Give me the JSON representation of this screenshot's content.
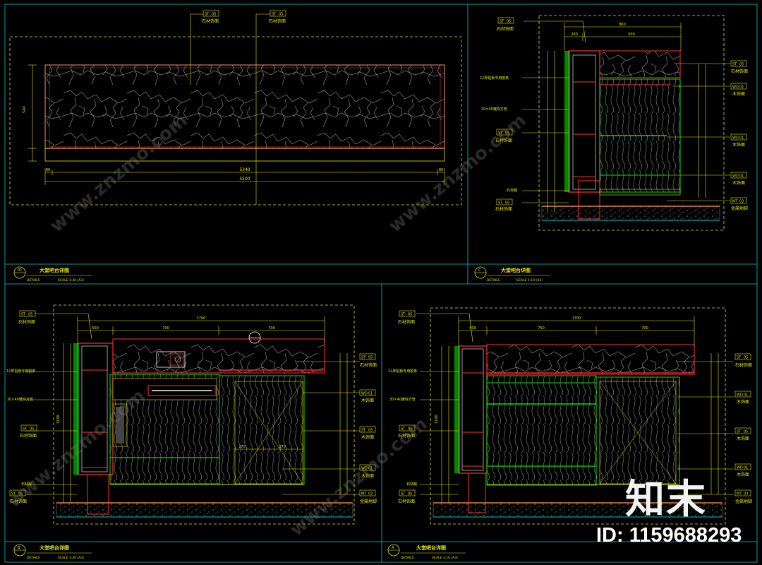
{
  "panels": [
    {
      "id": "01",
      "title": "大堂吧台详图",
      "sub": "DETAILS",
      "scale": "SCALE 1:30 (A3)"
    },
    {
      "id": "C",
      "title": "大堂吧台详图",
      "sub": "DETAILS",
      "scale": "SCALE 1:10 (A3)"
    },
    {
      "id": "B",
      "title": "大堂吧台详图",
      "sub": "DETAILS",
      "scale": "SCALE 1:30 (A3)"
    },
    {
      "id": "A",
      "title": "大堂吧台详图",
      "sub": "DETAILS",
      "scale": "SCALE 1:10 (A3)"
    }
  ],
  "tags": {
    "stone": "石材饰面",
    "wood": "木饰面",
    "metal": "金属地脚",
    "st": "ST",
    "wd": "WD",
    "mt": "MT",
    "num05": "05",
    "num08": "08",
    "num01": "01",
    "num03": "03"
  },
  "dims": {
    "d5500": "5500",
    "d5340": "5340",
    "d80": "80",
    "d860": "860",
    "d540": "540",
    "d200": "200",
    "d1700": "1700",
    "d500": "500",
    "d700": "700",
    "d750": "750",
    "d270": "270",
    "d1100": "1100"
  },
  "notes": {
    "n1": "12厚铝板专用胶条",
    "n2": "30×40镀锌方管",
    "n3": "石材踢"
  },
  "watermark": "www.znzmo.com",
  "logo": "知末",
  "id_text": "ID: 1159688293",
  "colors": {
    "yellow": "#e6e600",
    "red": "#ff2020",
    "green": "#00e000",
    "cyan": "#00c8c8",
    "white": "#e8e8e8",
    "bg": "#000000"
  }
}
